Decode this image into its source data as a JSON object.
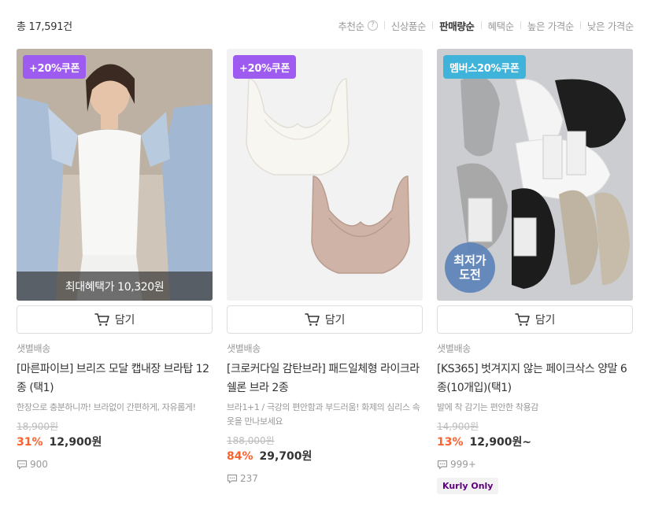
{
  "header": {
    "total": "총 17,591건"
  },
  "sort_options": [
    "추천순",
    "신상품순",
    "판매량순",
    "혜택순",
    "높은 가격순",
    "낮은 가격순"
  ],
  "sort_active": "판매량순",
  "cart_label": "담기",
  "products": [
    {
      "badge": "+20%쿠폰",
      "badge_color": "#9e5bf0",
      "benefit": "최대혜택가 10,320원",
      "shipping": "샛별배송",
      "name": "[마른파이브] 브리즈 모달 캡내장 브라탑 12종 (택1)",
      "desc": "한장으로 충분하니까! 브라없이 간편하게, 자유롭게!",
      "original_price": "18,900원",
      "discount": "31%",
      "price": "12,900원",
      "reviews": "900"
    },
    {
      "badge": "+20%쿠폰",
      "badge_color": "#9e5bf0",
      "shipping": "샛별배송",
      "name": "[크로커다일 감탄브라] 패드일체형 라이크라쉘론 브라 2종",
      "desc": "브라1+1 / 극강의 편안함과 부드러움! 화제의 심리스 속옷을 만나보세요",
      "original_price": "188,000원",
      "discount": "84%",
      "price": "29,700원",
      "reviews": "237"
    },
    {
      "badge": "멤버스20%쿠폰",
      "badge_color": "#3fb3d9",
      "lowest_line1": "최저가",
      "lowest_line2": "도전",
      "shipping": "샛별배송",
      "name": "[KS365] 벗겨지지 않는 페이크삭스 양말 6종(10개입)(택1)",
      "desc": "발에 착 감기는 편안한 착용감",
      "original_price": "14,900원",
      "discount": "13%",
      "price": "12,900원~",
      "reviews": "999+",
      "kurly_only": "Kurly Only"
    }
  ]
}
